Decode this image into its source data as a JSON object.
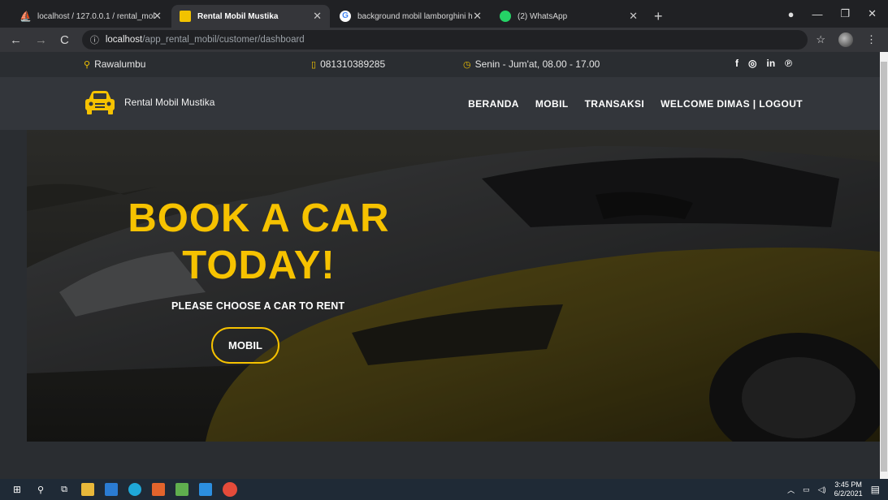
{
  "browser": {
    "tabs": [
      {
        "title": "localhost / 127.0.0.1 / rental_mol",
        "active": false
      },
      {
        "title": "Rental Mobil Mustika",
        "active": true
      },
      {
        "title": "background mobil lamborghini h",
        "active": false
      },
      {
        "title": "(2) WhatsApp",
        "active": false
      }
    ],
    "url_host": "localhost",
    "url_path": "/app_rental_mobil/customer/dashboard"
  },
  "topbar": {
    "location": "Rawalumbu",
    "phone": "081310389285",
    "hours": "Senin - Jum'at, 08.00 - 17.00",
    "social": [
      "f",
      "◎",
      "in",
      "℗"
    ]
  },
  "navbar": {
    "brand": "Rental Mobil Mustika",
    "menu": [
      "BERANDA",
      "MOBIL",
      "TRANSAKSI",
      "WELCOME DIMAS | LOGOUT"
    ]
  },
  "hero": {
    "title_line1": "BOOK A CAR",
    "title_line2": "TODAY!",
    "subtitle": "PLEASE CHOOSE A CAR TO RENT",
    "button": "MOBIL"
  },
  "taskbar": {
    "time": "3:45 PM",
    "date": "6/2/2021"
  },
  "colors": {
    "accent": "#f6c200",
    "background": "#2a2d31"
  }
}
